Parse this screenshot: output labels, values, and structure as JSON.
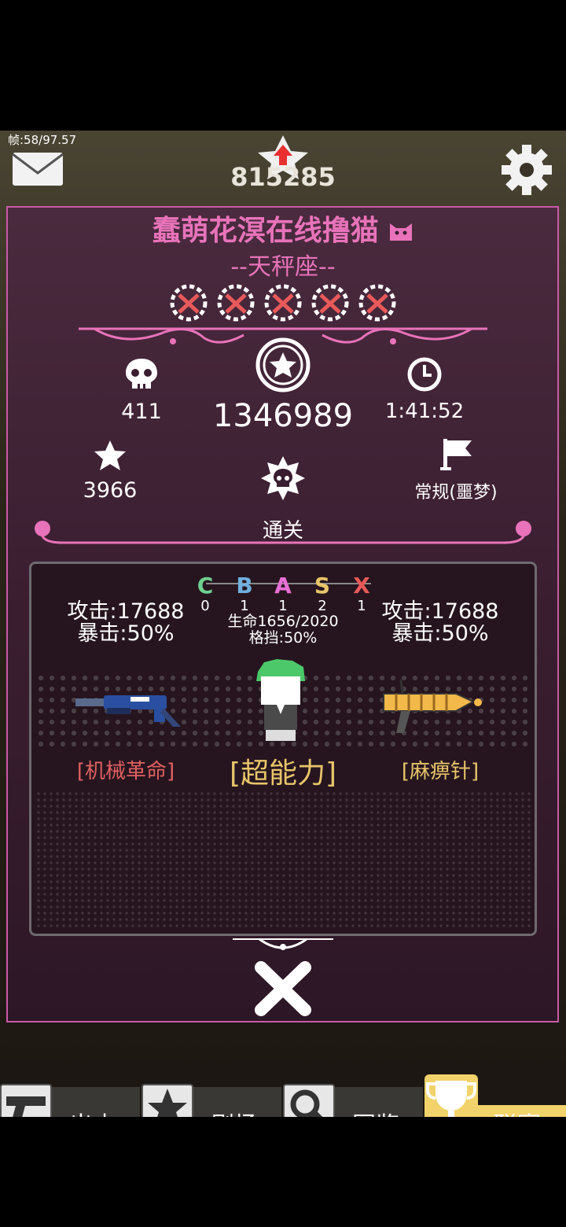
{
  "hud": {
    "fps": "帧:58/97.57",
    "score": "815285"
  },
  "player": {
    "name": "蠢萌花溟在线撸猫",
    "subtitle": "--天秤座--"
  },
  "stats": {
    "kills": "411",
    "points": "1346989",
    "time": "1:41:52",
    "stars": "3966",
    "result": "通关",
    "mode": "常规(噩梦)"
  },
  "grades": [
    {
      "letter": "C",
      "count": "0",
      "color": "#6fd08f"
    },
    {
      "letter": "B",
      "count": "1",
      "color": "#6fb0e0"
    },
    {
      "letter": "A",
      "count": "1",
      "color": "#e76fd6"
    },
    {
      "letter": "S",
      "count": "2",
      "color": "#e8c56a"
    },
    {
      "letter": "X",
      "count": "1",
      "color": "#e85a5a"
    }
  ],
  "left_weapon": {
    "attack": "攻击:17688",
    "crit": "暴击:50%",
    "name": "[机械革命]",
    "color": "#e06060"
  },
  "character": {
    "hp": "生命1656/2020",
    "block": "格挡:50%",
    "name": "[超能力]",
    "color": "#e8c56a"
  },
  "right_weapon": {
    "attack": "攻击:17688",
    "crit": "暴击:50%",
    "name": "[麻痹针]",
    "color": "#e8c56a"
  },
  "tabs": [
    {
      "label": "出击",
      "icon": "pistol-icon"
    },
    {
      "label": "剧场",
      "icon": "star-icon"
    },
    {
      "label": "图鉴",
      "icon": "magnifier-icon"
    },
    {
      "label": "联赛",
      "icon": "trophy-icon"
    }
  ],
  "colors": {
    "accent_pink": "#e873ba",
    "panel_border": "#c85aa8",
    "active_tab": "#f2d36b"
  }
}
